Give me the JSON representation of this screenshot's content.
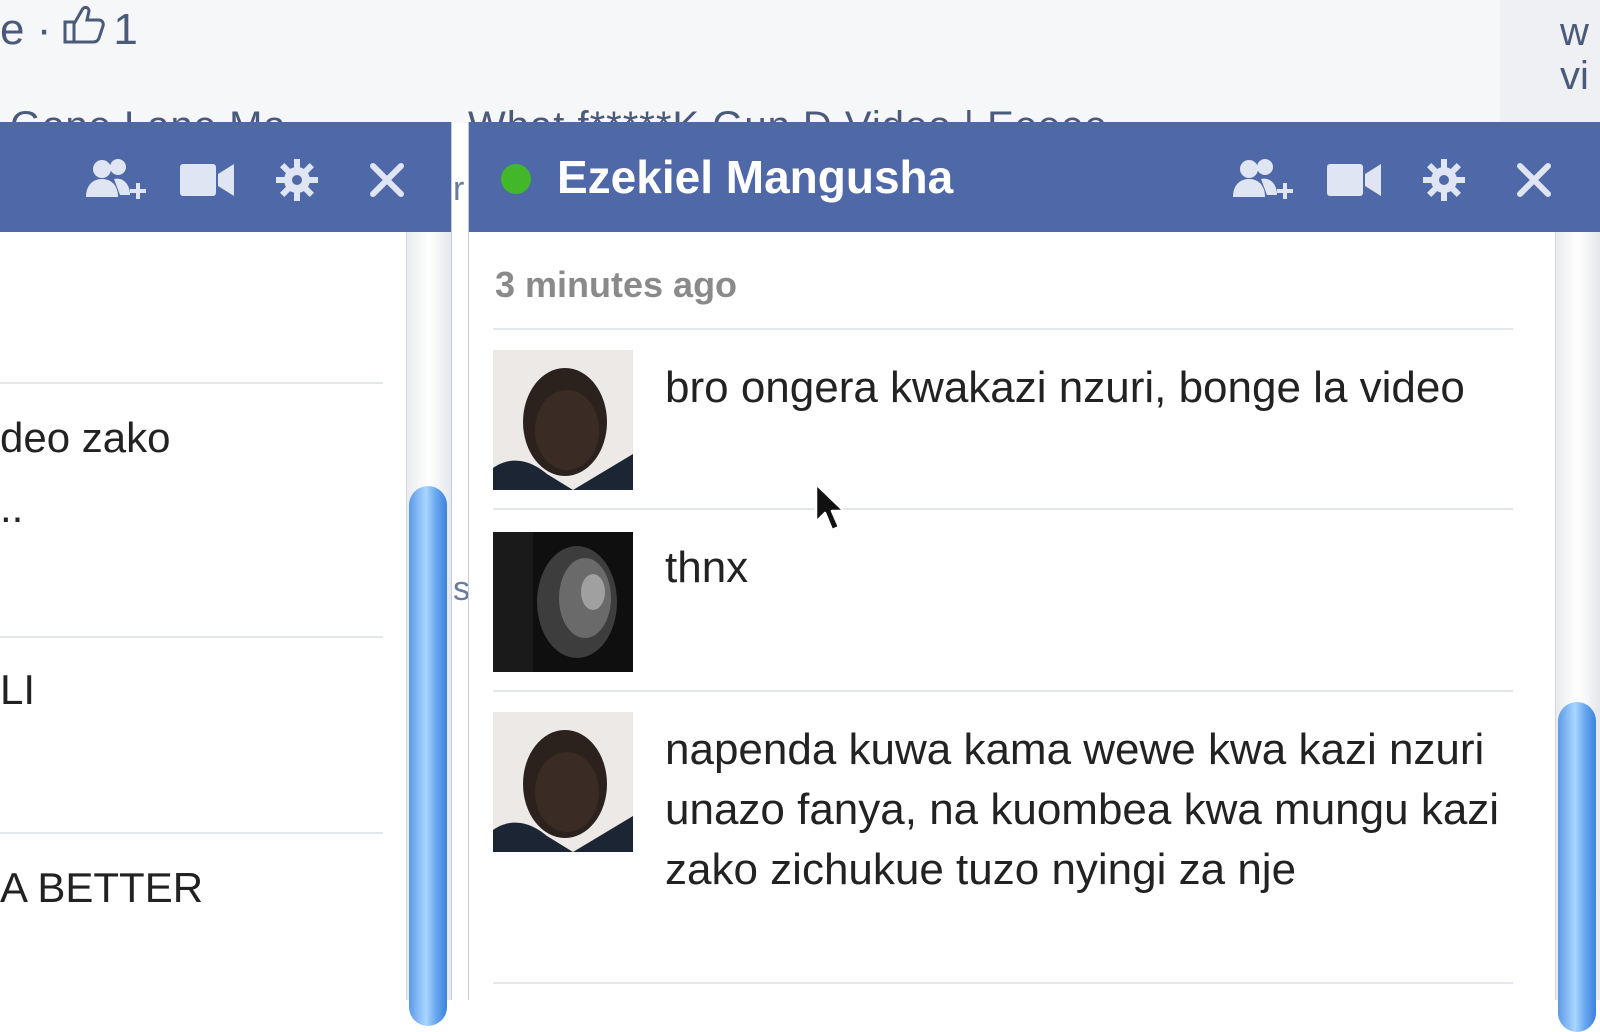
{
  "background": {
    "top_like_prefix": "e ·",
    "top_like_count": "1",
    "right_column_lines": [
      "w",
      "vi"
    ],
    "peek_left_text": "Gone Lane Ma",
    "peek_right_text": "What f*****K Gun D Video | Eeeee...",
    "gap_letters": [
      "r",
      "s"
    ]
  },
  "left_chat": {
    "rows": [
      "deo zako",
      "..",
      "LI",
      "A BETTER"
    ]
  },
  "right_chat": {
    "name": "Ezekiel Mangusha",
    "status": "online",
    "timestamp": "3 minutes ago",
    "messages": [
      {
        "sender": "contact",
        "text": "bro ongera kwakazi nzuri, bonge la video"
      },
      {
        "sender": "self",
        "text": "thnx"
      },
      {
        "sender": "contact",
        "text": "napenda kuwa kama wewe kwa kazi nzuri unazo fanya, na kuombea kwa mungu kazi zako zichukue tuzo nyingi za nje"
      }
    ]
  },
  "header_icons": [
    "add-friends-icon",
    "video-call-icon",
    "gear-icon",
    "close-icon"
  ],
  "colors": {
    "header_blue": "#4f68a8",
    "online_green": "#42b72a",
    "timestamp_gray": "#8a8a8a",
    "scroll_blue": "#5d9ae6"
  }
}
